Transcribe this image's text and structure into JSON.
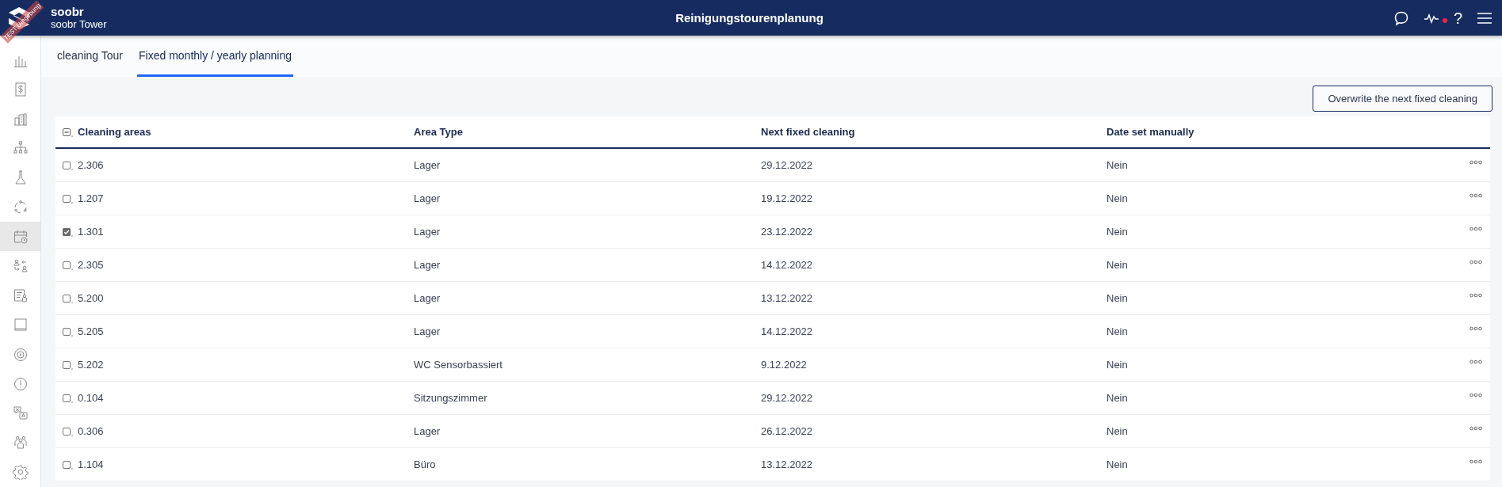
{
  "app": {
    "brand": "soobr",
    "site": "soobr Tower",
    "environment_ribbon": "TEST Umgebung"
  },
  "header": {
    "title": "Reinigungstourenplanung",
    "help_symbol": "?",
    "alert_dot": true
  },
  "sidebar": {
    "items": [
      {
        "selected": false
      },
      {
        "selected": false
      },
      {
        "selected": false
      },
      {
        "selected": false
      },
      {
        "selected": false
      },
      {
        "selected": false
      },
      {
        "selected": true
      },
      {
        "selected": false
      },
      {
        "selected": false
      },
      {
        "selected": false
      },
      {
        "selected": false
      },
      {
        "selected": false
      },
      {
        "selected": false
      },
      {
        "selected": false
      },
      {
        "selected": false
      }
    ]
  },
  "tabs": [
    {
      "label": "cleaning Tour",
      "selected": false
    },
    {
      "label": "Fixed monthly / yearly planning",
      "selected": true
    }
  ],
  "actions": {
    "overwrite_button": "Overwrite the next fixed cleaning"
  },
  "table": {
    "select_all": {
      "partial": true
    },
    "columns": [
      "Cleaning areas",
      "Area Type",
      "Next fixed cleaning",
      "Date set manually"
    ],
    "rows": [
      {
        "checked": false,
        "cells": [
          "2.306",
          "Lager",
          "29.12.2022",
          "Nein"
        ]
      },
      {
        "checked": false,
        "cells": [
          "1.207",
          "Lager",
          "19.12.2022",
          "Nein"
        ]
      },
      {
        "checked": true,
        "cells": [
          "1.301",
          "Lager",
          "23.12.2022",
          "Nein"
        ]
      },
      {
        "checked": false,
        "cells": [
          "2.305",
          "Lager",
          "14.12.2022",
          "Nein"
        ]
      },
      {
        "checked": false,
        "cells": [
          "5.200",
          "Lager",
          "13.12.2022",
          "Nein"
        ]
      },
      {
        "checked": false,
        "cells": [
          "5.205",
          "Lager",
          "14.12.2022",
          "Nein"
        ]
      },
      {
        "checked": false,
        "cells": [
          "5.202",
          "WC Sensorbassiert",
          "9.12.2022",
          "Nein"
        ]
      },
      {
        "checked": false,
        "cells": [
          "0.104",
          "Sitzungszimmer",
          "29.12.2022",
          "Nein"
        ]
      },
      {
        "checked": false,
        "cells": [
          "0.306",
          "Lager",
          "26.12.2022",
          "Nein"
        ]
      },
      {
        "checked": false,
        "cells": [
          "1.104",
          "Büro",
          "13.12.2022",
          "Nein"
        ]
      }
    ]
  }
}
